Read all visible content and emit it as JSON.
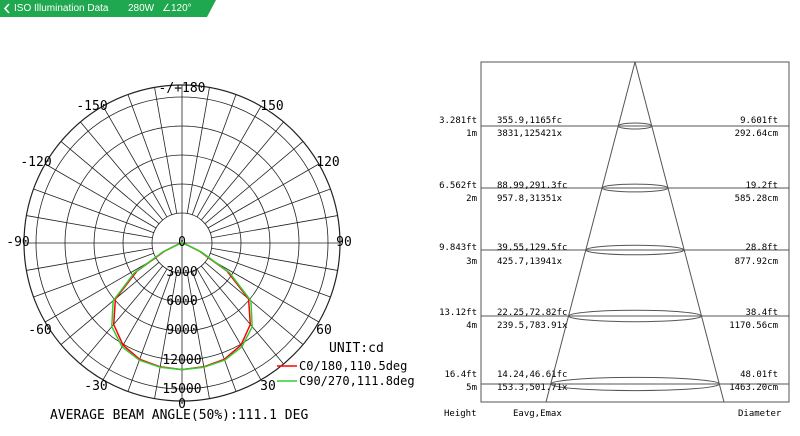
{
  "header_bar": {
    "title": "ISO Illumination Data",
    "wattage": "280W",
    "beam_angle": "∠120°",
    "accent_color": "#1fa84f",
    "icon": "chevron-left-icon"
  },
  "polar_chart": {
    "angle_labels": {
      "top": "-/+180",
      "n150": "-150",
      "p150": "150",
      "n120": "-120",
      "p120": "120",
      "n90": "-90",
      "p90": "90",
      "n60": "-60",
      "p60": "60",
      "n30": "-30",
      "p30": "30",
      "center": "0",
      "bottom": "0"
    },
    "radial_labels": [
      "3000",
      "6000",
      "9000",
      "12000",
      "15000"
    ],
    "unit": "UNIT:cd",
    "legend": [
      {
        "label": "C0/180,110.5deg",
        "color": "#ff0000"
      },
      {
        "label": "C90/270,111.8deg",
        "color": "#33cc33"
      }
    ],
    "average_beam_angle": "AVERAGE BEAM ANGLE(50%):111.1 DEG"
  },
  "chart_data": {
    "type": "polar",
    "rmax": 15000,
    "radial_ticks": [
      3000,
      6000,
      9000,
      12000,
      15000
    ],
    "series": [
      {
        "name": "C0/180,110.5deg",
        "color": "#ff0000",
        "angles": [
          -90,
          -75,
          -65,
          -58,
          -50,
          -40,
          -30,
          -20,
          -10,
          0,
          10,
          20,
          30,
          40,
          50,
          58,
          65,
          75,
          90
        ],
        "values": [
          0,
          300,
          2000,
          5500,
          9000,
          11000,
          12200,
          12800,
          13000,
          13100,
          13000,
          12800,
          12200,
          11000,
          9000,
          5500,
          2000,
          300,
          0
        ]
      },
      {
        "name": "C90/270,111.8deg",
        "color": "#33cc33",
        "angles": [
          -90,
          -75,
          -65,
          -58,
          -50,
          -40,
          -30,
          -20,
          -10,
          0,
          10,
          20,
          30,
          40,
          50,
          58,
          65,
          75,
          90
        ],
        "values": [
          0,
          300,
          2200,
          5800,
          9300,
          11300,
          12400,
          12900,
          13050,
          13100,
          13050,
          12900,
          12400,
          11300,
          9300,
          5800,
          2200,
          300,
          0
        ]
      }
    ]
  },
  "illumination_table": {
    "columns": {
      "height": "Height",
      "eavg": "Eavg,Emax",
      "diameter": "Diameter"
    },
    "rows": [
      {
        "height_ft": "3.281ft",
        "height_m": "1m",
        "fc": "355.9,1165fc",
        "lx": "3831,125421x",
        "dia_ft": "9.601ft",
        "dia_cm": "292.64cm"
      },
      {
        "height_ft": "6.562ft",
        "height_m": "2m",
        "fc": "88.99,291.3fc",
        "lx": "957.8,31351x",
        "dia_ft": "19.2ft",
        "dia_cm": "585.28cm"
      },
      {
        "height_ft": "9.843ft",
        "height_m": "3m",
        "fc": "39.55,129.5fc",
        "lx": "425.7,13941x",
        "dia_ft": "28.8ft",
        "dia_cm": "877.92cm"
      },
      {
        "height_ft": "13.12ft",
        "height_m": "4m",
        "fc": "22.25,72.82fc",
        "lx": "239.5,783.91x",
        "dia_ft": "38.4ft",
        "dia_cm": "1170.56cm"
      },
      {
        "height_ft": "16.4ft",
        "height_m": "5m",
        "fc": "14.24,46.61fc",
        "lx": "153.3,501.71x",
        "dia_ft": "48.01ft",
        "dia_cm": "1463.20cm"
      }
    ]
  }
}
